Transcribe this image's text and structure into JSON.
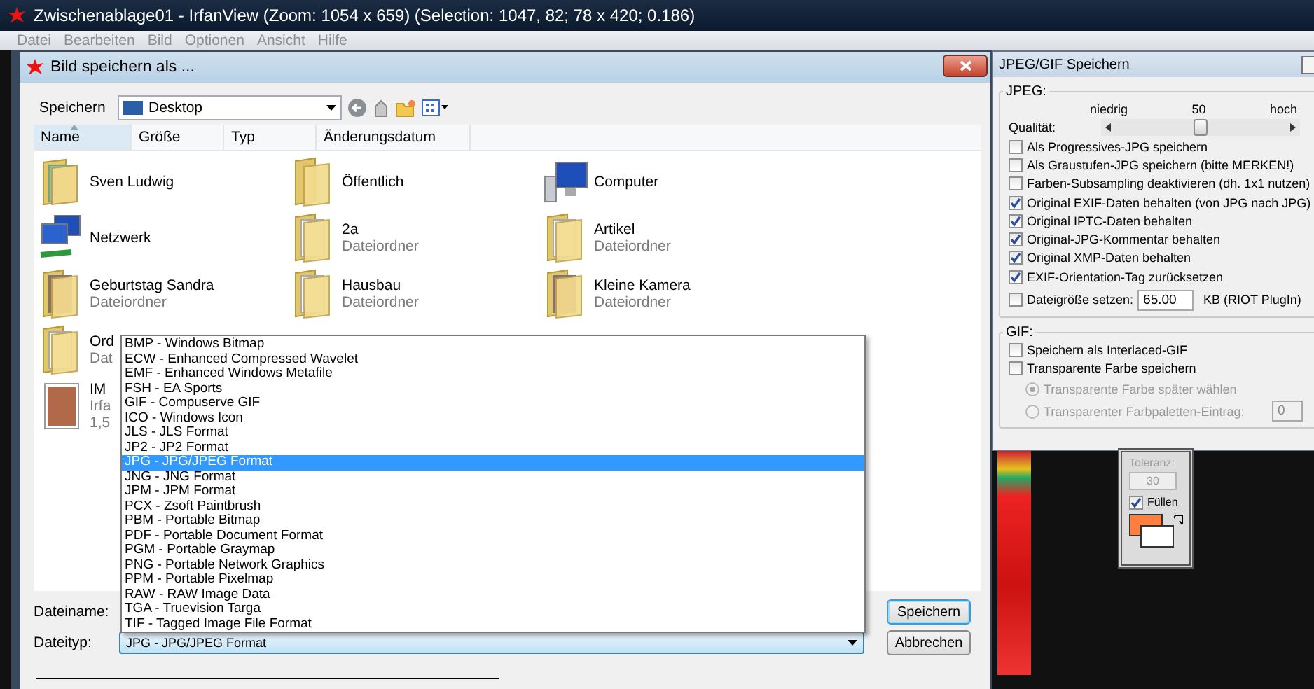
{
  "app_window": {
    "title": "Zwischenablage01 - IrfanView (Zoom: 1054 x 659) (Selection: 1047, 82; 78 x 420; 0.186)",
    "menu": [
      {
        "label": "Datei",
        "disabled": true
      },
      {
        "label": "Bearbeiten",
        "disabled": true
      },
      {
        "label": "Bild",
        "disabled": true
      },
      {
        "label": "Optionen",
        "disabled": true
      },
      {
        "label": "Ansicht",
        "disabled": true
      },
      {
        "label": "Hilfe",
        "disabled": true
      }
    ]
  },
  "save_dialog": {
    "title": "Bild speichern als ...",
    "location_label": "Speichern",
    "location": "Desktop",
    "columns": [
      {
        "label": "Name",
        "sorted": true
      },
      {
        "label": "Größe",
        "sorted": false
      },
      {
        "label": "Typ",
        "sorted": false
      },
      {
        "label": "Änderungsdatum",
        "sorted": false
      }
    ],
    "rows": [
      [
        {
          "kind": "user-folder",
          "name": "Sven Ludwig"
        },
        {
          "kind": "folder",
          "name": "Öffentlich"
        },
        {
          "kind": "computer",
          "name": "Computer"
        }
      ],
      [
        {
          "kind": "network",
          "name": "Netzwerk"
        },
        {
          "kind": "document-folder",
          "name": "2a",
          "details": [
            "Dateiordner"
          ]
        },
        {
          "kind": "document-folder",
          "name": "Artikel",
          "details": [
            "Dateiordner"
          ]
        }
      ],
      [
        {
          "kind": "photo-folder",
          "name": "Geburtstag Sandra",
          "details": [
            "Dateiordner"
          ]
        },
        {
          "kind": "document-folder",
          "name": "Hausbau",
          "details": [
            "Dateiordner"
          ]
        },
        {
          "kind": "photo-folder",
          "name": "Kleine Kamera",
          "details": [
            "Dateiordner"
          ]
        }
      ],
      [
        {
          "kind": "document-folder",
          "name": "Ord",
          "details": [
            "Dat"
          ]
        }
      ],
      [
        {
          "kind": "photo",
          "name": "IM",
          "details": [
            "Irfa",
            "1,5"
          ]
        }
      ]
    ],
    "file_types": [
      {
        "label": "BMP - Windows Bitmap",
        "selected": false
      },
      {
        "label": "ECW - Enhanced Compressed Wavelet",
        "selected": false
      },
      {
        "label": "EMF - Enhanced Windows Metafile",
        "selected": false
      },
      {
        "label": "FSH - EA Sports",
        "selected": false
      },
      {
        "label": "GIF - Compuserve GIF",
        "selected": false
      },
      {
        "label": "ICO - Windows Icon",
        "selected": false
      },
      {
        "label": "JLS - JLS Format",
        "selected": false
      },
      {
        "label": "JP2 - JP2 Format",
        "selected": false
      },
      {
        "label": "JPG - JPG/JPEG Format",
        "selected": true
      },
      {
        "label": "JNG - JNG Format",
        "selected": false
      },
      {
        "label": "JPM - JPM Format",
        "selected": false
      },
      {
        "label": "PCX - Zsoft Paintbrush",
        "selected": false
      },
      {
        "label": "PBM - Portable Bitmap",
        "selected": false
      },
      {
        "label": "PDF - Portable Document Format",
        "selected": false
      },
      {
        "label": "PGM - Portable Graymap",
        "selected": false
      },
      {
        "label": "PNG - Portable Network Graphics",
        "selected": false
      },
      {
        "label": "PPM - Portable Pixelmap",
        "selected": false
      },
      {
        "label": "RAW - RAW Image Data",
        "selected": false
      },
      {
        "label": "TGA - Truevision Targa",
        "selected": false
      },
      {
        "label": "TIF - Tagged Image File Format",
        "selected": false
      }
    ],
    "filename_label": "Dateiname:",
    "filetype_label": "Dateityp:",
    "filetype": "JPG - JPG/JPEG Format",
    "buttons": [
      {
        "label": "Speichern",
        "default": true
      },
      {
        "label": "Abbrechen",
        "default": false
      }
    ]
  },
  "jpeg_panel": {
    "title": "JPEG/GIF Speichern",
    "jpeg_group": "JPEG:",
    "low": "niedrig",
    "value": "50",
    "high": "hoch",
    "quality_label": "Qualität:",
    "level": 0.5,
    "options": [
      {
        "label": "Als Progressives-JPG speichern",
        "checked": false
      },
      {
        "label": "Als Graustufen-JPG speichern (bitte MERKEN!)",
        "checked": false
      },
      {
        "label": "Farben-Subsampling deaktivieren (dh. 1x1 nutzen)",
        "checked": false
      },
      {
        "label": "Original EXIF-Daten behalten (von JPG nach JPG)",
        "checked": true
      },
      {
        "label": "Original IPTC-Daten behalten",
        "checked": true
      },
      {
        "label": "Original-JPG-Kommentar behalten",
        "checked": true
      },
      {
        "label": "Original XMP-Daten behalten",
        "checked": true
      },
      {
        "label": "EXIF-Orientation-Tag zurücksetzen",
        "checked": true
      }
    ],
    "filesize": {
      "label": "Dateigröße setzen:",
      "checked": false,
      "value": "65.00",
      "unit": "KB (RIOT PlugIn)"
    },
    "gif_group": "GIF:",
    "gif_options": [
      {
        "label": "Speichern als Interlaced-GIF",
        "checked": false
      },
      {
        "label": "Transparente Farbe speichern",
        "checked": false
      }
    ],
    "transparency": [
      {
        "label": "Transparente Farbe später wählen",
        "selected": true
      },
      {
        "label": "Transparenter Farbpaletten-Eintrag:",
        "selected": false
      }
    ],
    "palette_entry": "0"
  },
  "tool_palette": {
    "tolerance_label": "Toleranz:",
    "tolerance": "30",
    "fill_label": "Füllen",
    "fill_checked": true
  }
}
